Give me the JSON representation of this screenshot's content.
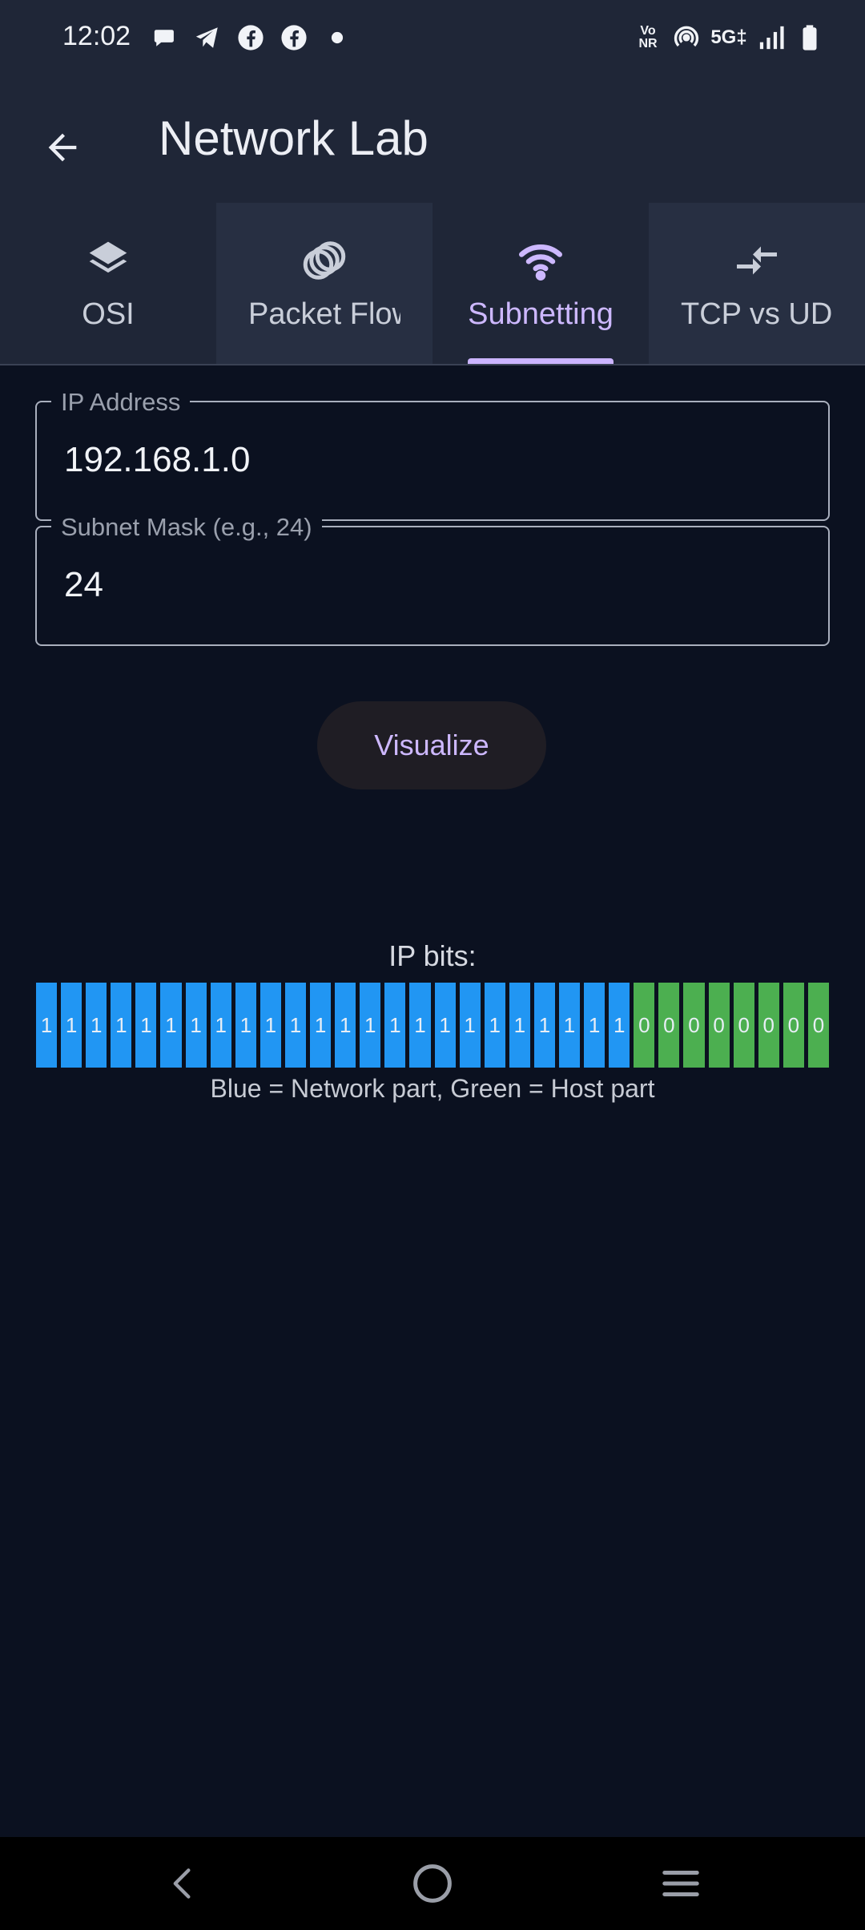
{
  "status": {
    "time": "12:02",
    "left_icons": [
      "chat-bubble-icon",
      "telegram-icon",
      "facebook-icon",
      "facebook-icon",
      "dot-icon"
    ],
    "right_icons": [
      "vonr-icon",
      "hotspot-icon",
      "network-5g-icon",
      "signal-icon",
      "battery-icon"
    ],
    "vonr_label_top": "Vo",
    "vonr_label_bottom": "NR",
    "network_label": "5G‡"
  },
  "appbar": {
    "title": "Network Lab",
    "back_icon": "arrow-back-icon"
  },
  "tabs": [
    {
      "label": "OSI",
      "icon": "layers-icon",
      "selected": false
    },
    {
      "label": "Packet Flow",
      "icon": "rings-icon",
      "selected": false
    },
    {
      "label": "Subnetting",
      "icon": "wifi-icon",
      "selected": true
    },
    {
      "label": "TCP vs UDP",
      "icon": "compare-arrows-icon",
      "selected": false
    }
  ],
  "form": {
    "ip_label": "IP Address",
    "ip_value": "192.168.1.0",
    "mask_label": "Subnet Mask (e.g., 24)",
    "mask_value": "24",
    "visualize_label": "Visualize"
  },
  "bits": {
    "title": "IP bits:",
    "values": [
      "1",
      "1",
      "1",
      "1",
      "1",
      "1",
      "1",
      "1",
      "1",
      "1",
      "1",
      "1",
      "1",
      "1",
      "1",
      "1",
      "1",
      "1",
      "1",
      "1",
      "1",
      "1",
      "1",
      "1",
      "0",
      "0",
      "0",
      "0",
      "0",
      "0",
      "0",
      "0"
    ],
    "network_color": "#2196f3",
    "host_color": "#4caf50",
    "legend": "Blue = Network part, Green = Host part"
  },
  "navbar": {
    "icons": [
      "nav-back-icon",
      "nav-home-icon",
      "nav-recents-icon"
    ]
  },
  "colors": {
    "background": "#0b1120",
    "header": "#1f2637",
    "accent": "#cbb4ff"
  }
}
